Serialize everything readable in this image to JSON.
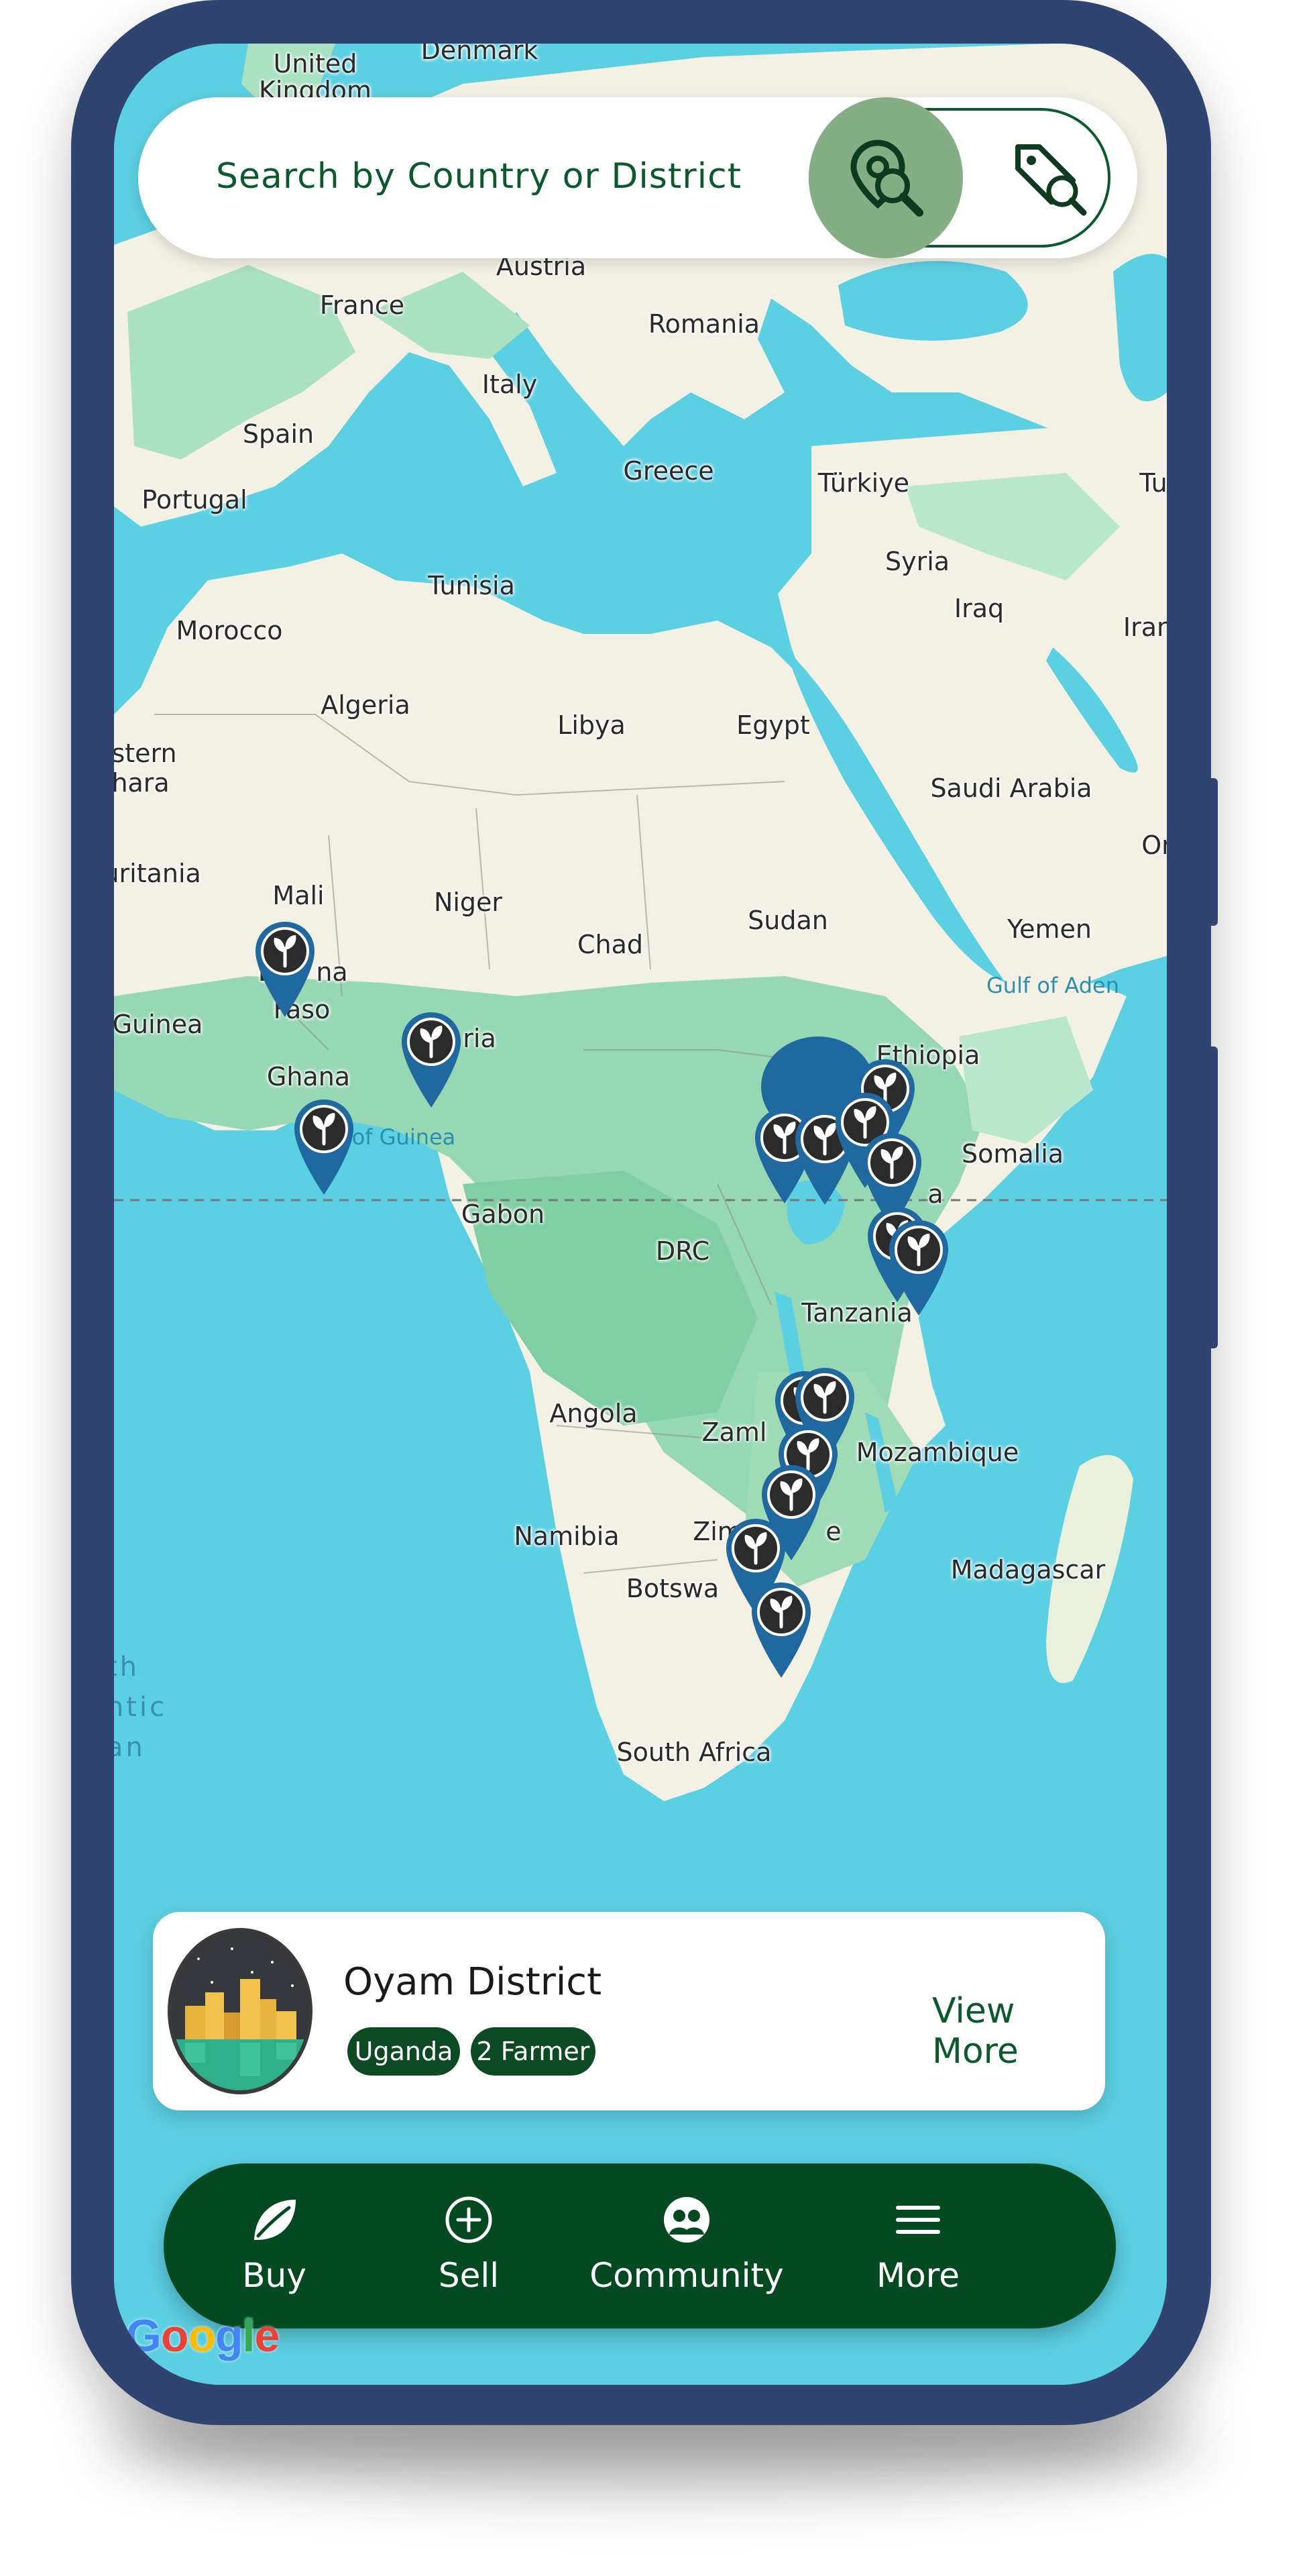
{
  "search": {
    "placeholder": "Search by Country or District",
    "active_icon": "location-search-icon",
    "secondary_icon": "tag-search-icon"
  },
  "map": {
    "labels": {
      "united_kingdom": "United\nKingdom",
      "denmark": "Denmark",
      "austria": "Austria",
      "france": "France",
      "romania": "Romania",
      "italy": "Italy",
      "spain": "Spain",
      "portugal": "Portugal",
      "greece": "Greece",
      "turkiye": "Türkiye",
      "tunisia": "Tunisia",
      "syria": "Syria",
      "iraq": "Iraq",
      "iran": "Iran",
      "morocco": "Morocco",
      "algeria": "Algeria",
      "libya": "Libya",
      "egypt": "Egypt",
      "western_sahara": "stern\nhara",
      "saudi_arabia": "Saudi Arabia",
      "oman": "Or",
      "mauritania": "auritania",
      "mali": "Mali",
      "niger": "Niger",
      "chad": "Chad",
      "sudan": "Sudan",
      "yemen": "Yemen",
      "gulf_of_aden": "Gulf of Aden",
      "burkina_faso_a": "Bu",
      "burkina_faso_b": "na",
      "burkina_faso_c": "Faso",
      "guinea": "Guinea",
      "nigeria": "ria",
      "ethiopia": "Ethiopia",
      "ghana": "Ghana",
      "gulf_of_guinea": "of Guinea",
      "somalia": "Somalia",
      "kenya": "a",
      "gabon": "Gabon",
      "drc": "DRC",
      "tanzania": "Tanzania",
      "angola": "Angola",
      "zambia": "Zaml",
      "mozambique": "Mozambique",
      "namibia": "Namibia",
      "zimbabwe": "Zim",
      "zimbabwe_end": "e",
      "madagascar": "Madagascar",
      "botswana": "Botswa",
      "south_atlantic": "th\nntic\nan",
      "south_africa": "South Africa",
      "turkey_edge": "Tu"
    },
    "pin_icon": "farm-sprout-pin-icon",
    "cluster_icon": "pin-cluster-icon"
  },
  "card": {
    "district": "Oyam District",
    "chips": [
      "Uganda",
      "2 Farmer"
    ],
    "action": "View More",
    "avatar_icon": "city-illustration-avatar"
  },
  "nav": [
    {
      "label": "Buy",
      "icon": "leaf-icon"
    },
    {
      "label": "Sell",
      "icon": "plus-circle-icon"
    },
    {
      "label": "Community",
      "icon": "community-icon"
    },
    {
      "label": "More",
      "icon": "menu-icon"
    }
  ],
  "attribution": "Google",
  "colors": {
    "frame": "#2f4470",
    "ocean": "#5cd0e3",
    "land": "#f3f0e4",
    "vegetation": "#9fdcb6",
    "primary_green": "#034a20",
    "pin_blue": "#1f68a0",
    "search_active": "#86ae84"
  }
}
